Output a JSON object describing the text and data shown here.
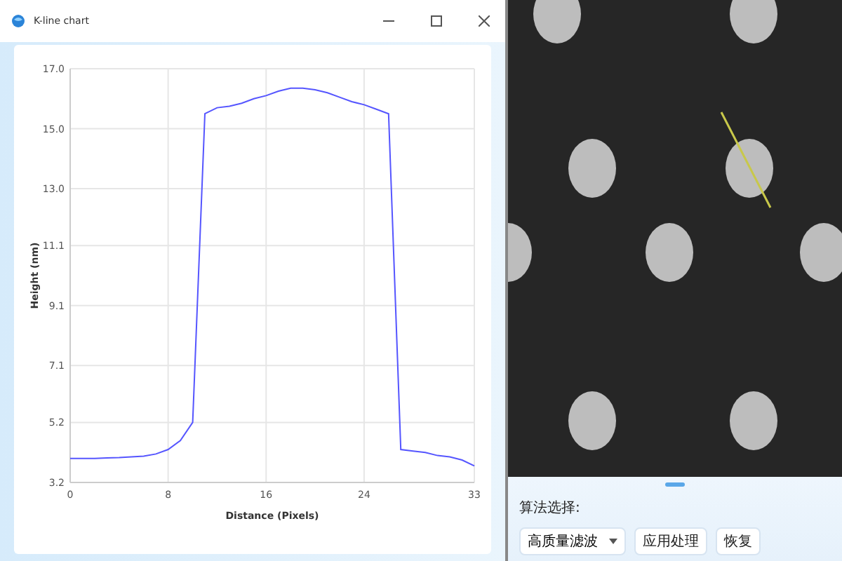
{
  "window": {
    "title": "K-line chart"
  },
  "chart_data": {
    "type": "line",
    "xlabel": "Distance (Pixels)",
    "ylabel": "Height (nm)",
    "x": [
      0,
      1,
      2,
      3,
      4,
      5,
      6,
      7,
      8,
      9,
      10,
      11,
      12,
      13,
      14,
      15,
      16,
      17,
      18,
      19,
      20,
      21,
      22,
      23,
      24,
      25,
      26,
      27,
      28,
      29,
      30,
      31,
      32,
      33
    ],
    "series": [
      {
        "color": "#5555ff",
        "values": [
          4.0,
          4.0,
          4.0,
          4.02,
          4.03,
          4.05,
          4.08,
          4.15,
          4.3,
          4.6,
          5.2,
          15.5,
          15.7,
          15.75,
          15.85,
          16.0,
          16.1,
          16.25,
          16.35,
          16.35,
          16.3,
          16.2,
          16.05,
          15.9,
          15.8,
          15.65,
          15.5,
          4.3,
          4.25,
          4.2,
          4.1,
          4.05,
          3.95,
          3.75
        ]
      }
    ],
    "xlim": [
      0,
      33
    ],
    "ylim": [
      3.2,
      17.0
    ],
    "xticks": [
      0,
      8,
      16,
      24,
      33
    ],
    "yticks": [
      {
        "value": 3.2,
        "label": "3.2"
      },
      {
        "value": 5.2,
        "label": "5.2"
      },
      {
        "value": 7.1,
        "label": "7.1"
      },
      {
        "value": 9.1,
        "label": "9.1"
      },
      {
        "value": 11.1,
        "label": "11.1"
      },
      {
        "value": 13,
        "label": "13.0"
      },
      {
        "value": 15,
        "label": "15.0"
      },
      {
        "value": 17,
        "label": "17.0"
      }
    ],
    "grid": true
  },
  "controls": {
    "label": "算法选择:",
    "dropdown": "高质量滤波",
    "buttons": [
      "应用处理",
      "恢复"
    ]
  }
}
